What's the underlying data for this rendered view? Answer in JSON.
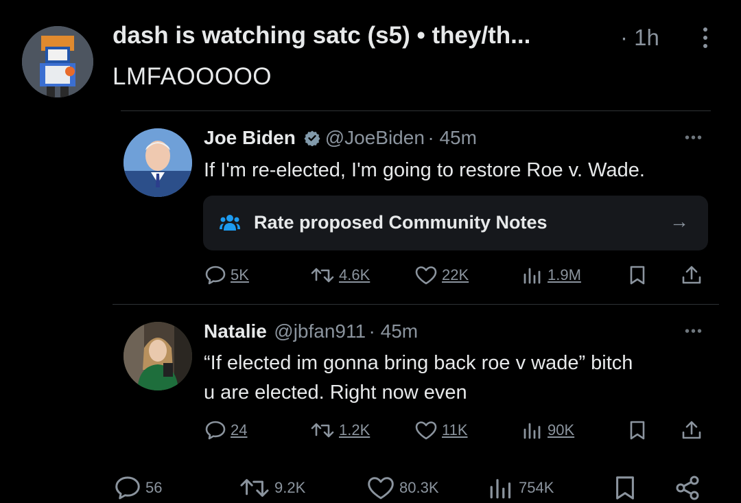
{
  "outer": {
    "name": "dash is watching satc (s5) • they/th...",
    "time": "· 1h",
    "text": "LMFAOOOOO"
  },
  "quoted": {
    "name": "Joe Biden",
    "handle": "@JoeBiden",
    "time": "· 45m",
    "text": "If I'm re-elected, I'm going to restore Roe v. Wade.",
    "community_notes": "Rate proposed Community Notes",
    "arrow": "→",
    "stats": {
      "replies": "5K",
      "reposts": "4.6K",
      "likes": "22K",
      "views": "1.9M"
    }
  },
  "reply": {
    "name": "Natalie",
    "handle": "@jbfan911",
    "time": "· 45m",
    "text_line1": "“If elected im gonna bring back roe v wade” bitch",
    "text_line2": "u are elected. Right now even",
    "stats": {
      "replies": "24",
      "reposts": "1.2K",
      "likes": "11K",
      "views": "90K"
    }
  },
  "outer_stats": {
    "replies": "56",
    "reposts": "9.2K",
    "likes": "80.3K",
    "views": "754K"
  },
  "colors": {
    "background": "#000000",
    "text": "#e7e9ea",
    "muted": "#8b949e",
    "verified": "#829aab",
    "notes_icon": "#1d9bf0"
  }
}
